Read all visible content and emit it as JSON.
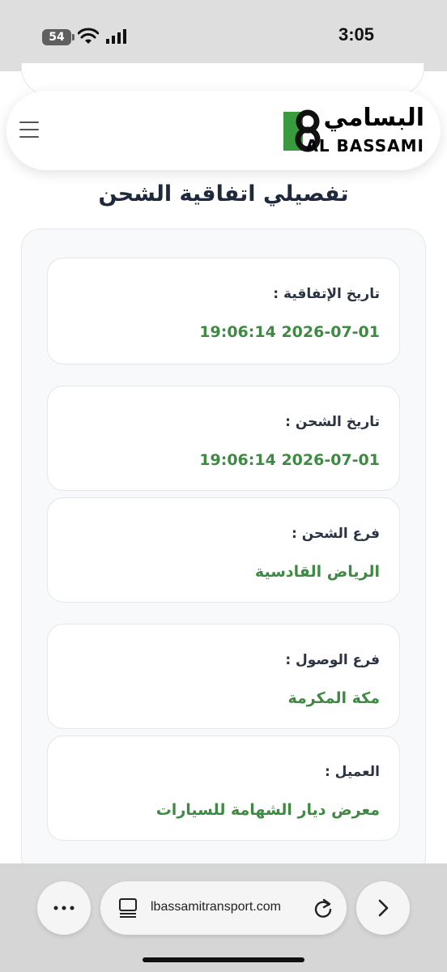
{
  "status_bar": {
    "time": "3:05",
    "battery_level": "54"
  },
  "header": {
    "logo_arabic": "البسامي",
    "logo_english": "AL BASSAMI",
    "brand_color": "#3a9a3e"
  },
  "page": {
    "title": "تفصيلي اتفاقية الشحن"
  },
  "fields": [
    {
      "label": "تاريخ الإتفاقية :",
      "value": "2026-07-01 19:06:14"
    },
    {
      "label": "تاريخ الشحن :",
      "value": "2026-07-01 19:06:14"
    },
    {
      "label": "فرع الشحن :",
      "value": "الرياض القادسية"
    },
    {
      "label": "فرع الوصول :",
      "value": "مكة المكرمة"
    },
    {
      "label": "العميل :",
      "value": "معرض ديار الشهامة للسيارات"
    }
  ],
  "browser": {
    "url": "lbassamitransport.com",
    "value_color": "#3f8a43"
  }
}
